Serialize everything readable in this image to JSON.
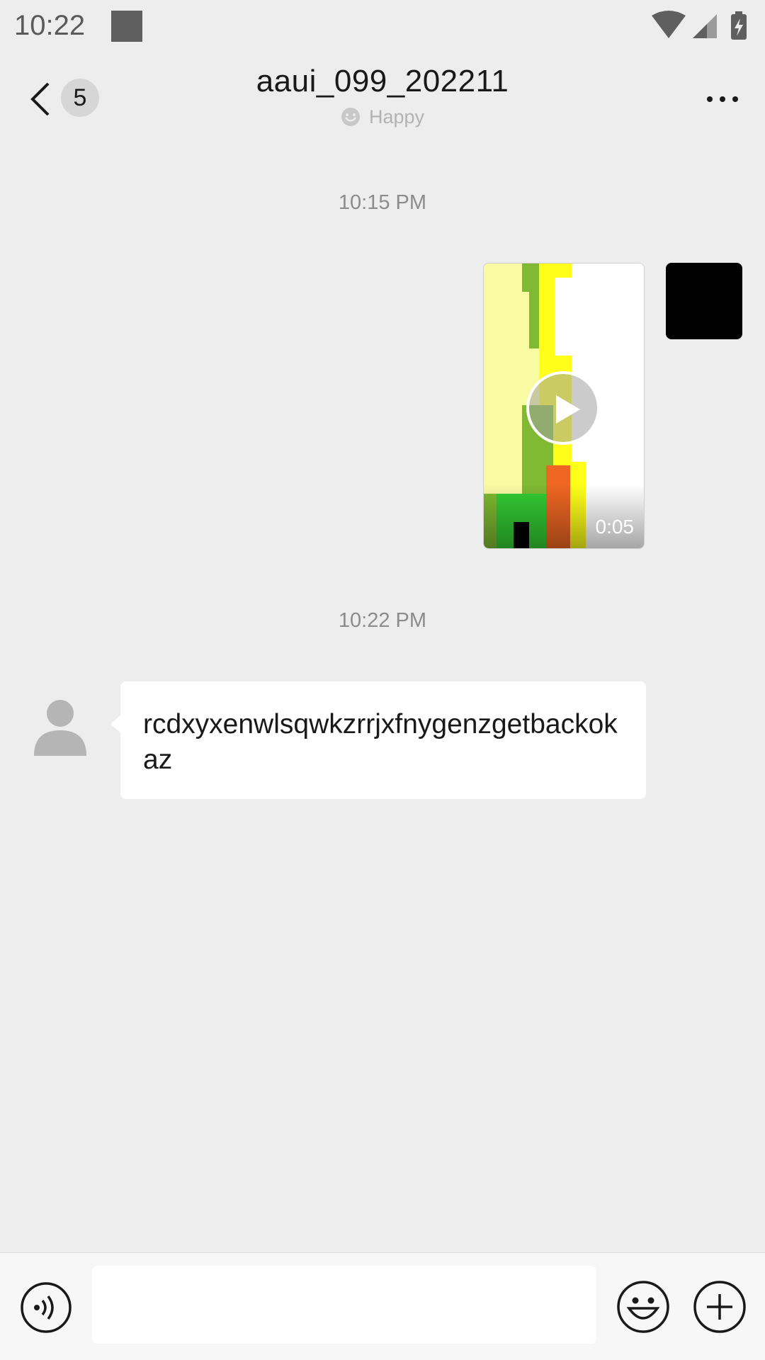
{
  "status_bar": {
    "time": "10:22",
    "icons": [
      "notification-square-icon",
      "wifi-icon",
      "signal-icon",
      "battery-charging-icon"
    ]
  },
  "header": {
    "back_badge_count": "5",
    "title": "aaui_099_202211",
    "status_text": "Happy",
    "back_icon": "chevron-left-icon",
    "more_icon": "more-dots-icon"
  },
  "messages": [
    {
      "type": "timestamp",
      "text": "10:15 PM"
    },
    {
      "type": "video",
      "direction": "outgoing",
      "duration": "0:05"
    },
    {
      "type": "timestamp",
      "text": "10:22 PM"
    },
    {
      "type": "text",
      "direction": "incoming",
      "text": "rcdxyxenwlsqwkzrrjxfnygenzgetbackokaz"
    }
  ],
  "input_bar": {
    "placeholder": "",
    "voice_icon": "voice-icon",
    "emoji_icon": "emoji-icon",
    "plus_icon": "plus-icon"
  },
  "colors": {
    "background": "#ededed",
    "bubble": "#ffffff",
    "text": "#191919",
    "muted": "#8c8c8c"
  }
}
